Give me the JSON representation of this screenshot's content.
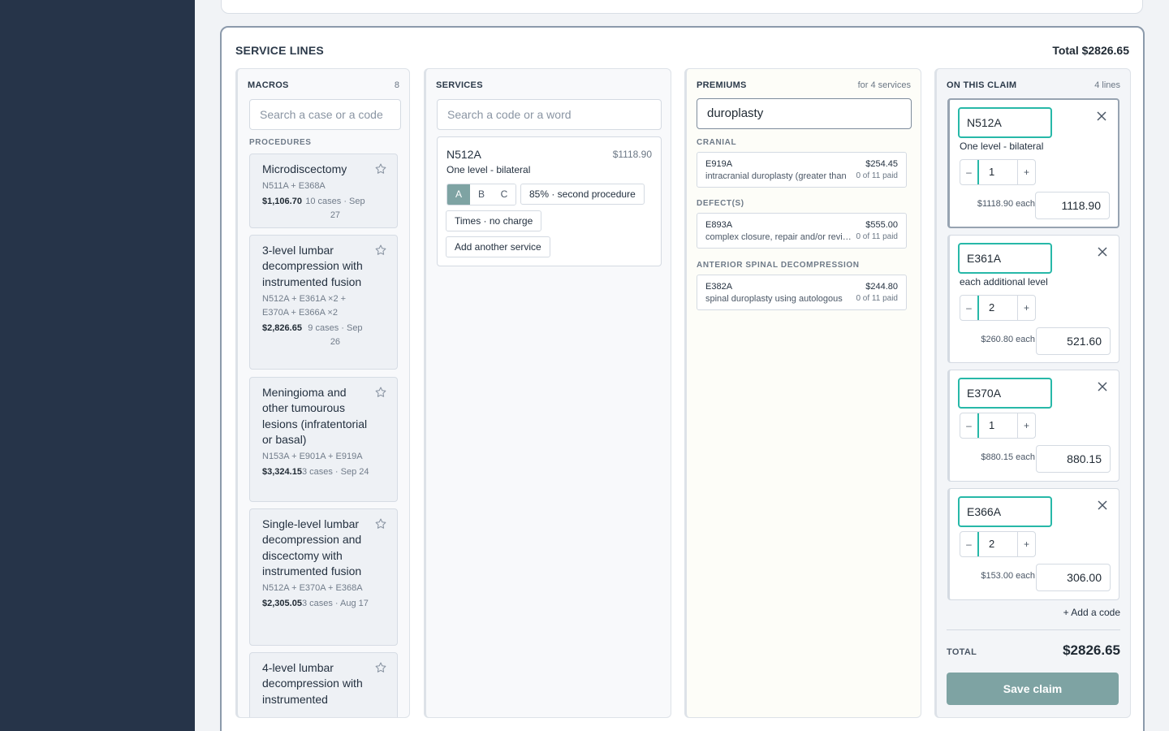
{
  "panel": {
    "title": "SERVICE LINES",
    "total": "Total $2826.65"
  },
  "macros": {
    "header": "MACROS",
    "count": "8",
    "search_placeholder": "Search a case or a code",
    "section": "PROCEDURES",
    "items": [
      {
        "name": "Microdiscectomy",
        "codes": "N511A + E368A",
        "price": "$1,106.70",
        "cases": "10 cases · Sep 27"
      },
      {
        "name": "3-level lumbar decompression with instrumented fusion",
        "codes": "N512A + E361A ×2 + E370A + E366A ×2",
        "price": "$2,826.65",
        "cases": "9 cases · Sep 26"
      },
      {
        "name": "Meningioma and other tumourous lesions (infratentorial or basal)",
        "codes": "N153A + E901A + E919A",
        "price": "$3,324.15",
        "cases": "3 cases · Sep 24"
      },
      {
        "name": "Single-level lumbar decompression and discectomy with instrumented fusion",
        "codes": "N512A + E370A + E368A",
        "price": "$2,305.05",
        "cases": "3 cases · Aug 17"
      },
      {
        "name": "4-level lumbar decompression with instrumented",
        "codes": "",
        "price": "",
        "cases": ""
      }
    ]
  },
  "services": {
    "header": "SERVICES",
    "search_placeholder": "Search a code or a word",
    "card": {
      "code": "N512A",
      "price": "$1118.90",
      "desc": "One level - bilateral",
      "options": [
        "A",
        "B",
        "C"
      ],
      "selected": "A",
      "modifier": "85% · second procedure",
      "no_charge": "Times · no charge",
      "add_another": "Add another service"
    }
  },
  "premiums": {
    "header": "PREMIUMS",
    "meta": "for 4 services",
    "search_value": "duroplasty",
    "groups": [
      {
        "label": "CRANIAL",
        "code": "E919A",
        "desc": "intracranial duroplasty (greater than",
        "price": "$254.45",
        "paid": "0 of 11 paid"
      },
      {
        "label": "DEFECT(S)",
        "code": "E893A",
        "desc": "complex closure, repair and/or revision",
        "price": "$555.00",
        "paid": "0 of 11 paid"
      },
      {
        "label": "ANTERIOR SPINAL DECOMPRESSION",
        "code": "E382A",
        "desc": "spinal duroplasty using autologous",
        "price": "$244.80",
        "paid": "0 of 11 paid"
      }
    ]
  },
  "claim": {
    "header": "ON THIS CLAIM",
    "meta": "4 lines",
    "lines": [
      {
        "code": "N512A",
        "desc": "One level - bilateral",
        "qty": "1",
        "each": "$1118.90 each",
        "amount": "1118.90"
      },
      {
        "code": "E361A",
        "desc": "each additional level",
        "qty": "2",
        "each": "$260.80 each",
        "amount": "521.60"
      },
      {
        "code": "E370A",
        "desc": "",
        "qty": "1",
        "each": "$880.15 each",
        "amount": "880.15"
      },
      {
        "code": "E366A",
        "desc": "",
        "qty": "2",
        "each": "$153.00 each",
        "amount": "306.00"
      }
    ],
    "stepper_minus": "–",
    "stepper_plus": "+",
    "add_code": "+ Add a code",
    "total_label": "TOTAL",
    "total_value": "$2826.65",
    "save_label": "Save claim"
  },
  "colors": {
    "sidebar": "#263449",
    "accent": "#27b8a8",
    "save": "#7ea3a3"
  },
  "icons": {
    "favorite": "star-icon",
    "remove": "close-icon"
  }
}
